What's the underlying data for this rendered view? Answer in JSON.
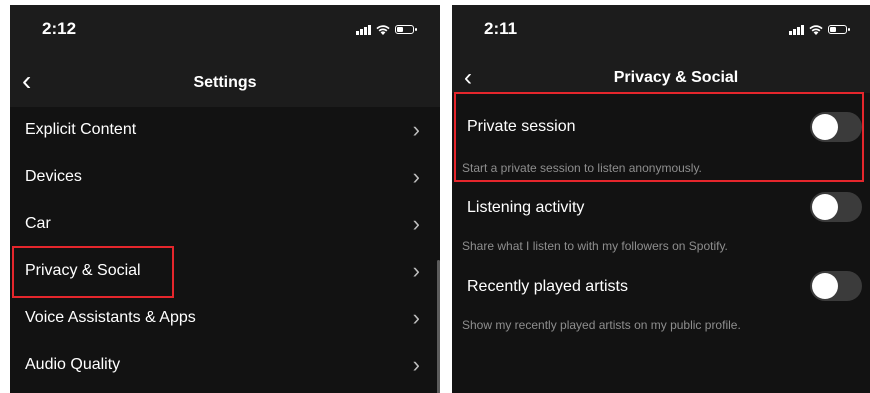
{
  "left_screen": {
    "time": "2:12",
    "back_glyph": "‹",
    "title": "Settings",
    "items": [
      {
        "label": "Explicit Content"
      },
      {
        "label": "Devices"
      },
      {
        "label": "Car"
      },
      {
        "label": "Privacy & Social"
      },
      {
        "label": "Voice Assistants & Apps"
      },
      {
        "label": "Audio Quality"
      }
    ],
    "chevron_glyph": "›",
    "highlighted_item": "Privacy & Social"
  },
  "right_screen": {
    "time": "2:11",
    "back_glyph": "‹",
    "title": "Privacy & Social",
    "settings": [
      {
        "label": "Private session",
        "description": "Start a private session to listen anonymously.",
        "enabled": false
      },
      {
        "label": "Listening activity",
        "description": "Share what I listen to with my followers on Spotify.",
        "enabled": false
      },
      {
        "label": "Recently played artists",
        "description": "Show my recently played artists on my public profile.",
        "enabled": false
      }
    ],
    "highlighted_setting": "Private session"
  },
  "colors": {
    "background": "#121212",
    "header": "#1c1c1c",
    "highlight": "#e5262c",
    "toggle_off": "#3b3b3b",
    "secondary_text": "#8e8e8e"
  }
}
